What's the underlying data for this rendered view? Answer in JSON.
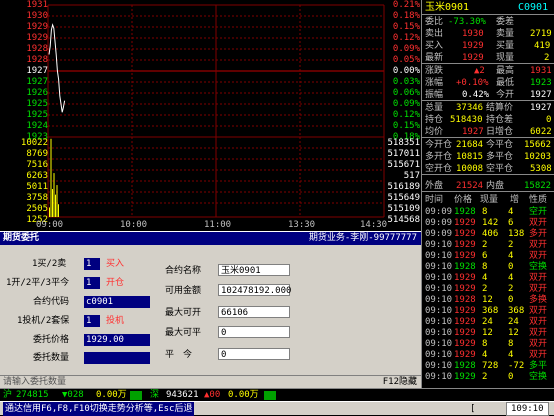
{
  "chart": {
    "price_labels": [
      "1931",
      "1930",
      "1929",
      "1929",
      "1928",
      "1928",
      "1927",
      "1927",
      "1926",
      "1925",
      "1925",
      "1924",
      "1923"
    ],
    "pct_labels": [
      "0.21%",
      "0.18%",
      "0.15%",
      "0.12%",
      "0.09%",
      "0.05%",
      "0.00%",
      "0.03%",
      "0.06%",
      "0.09%",
      "0.12%",
      "0.15%",
      "0.18%"
    ],
    "vol_labels_left": [
      "10022",
      "8769",
      "7516",
      "6263",
      "5011",
      "3758",
      "2505",
      "1252"
    ],
    "vol_labels_right": [
      "518351",
      "517011",
      "515671",
      "517",
      "516189",
      "515649",
      "515109",
      "514568"
    ],
    "time_labels": [
      "09:00",
      "10:00",
      "11:00",
      "13:30",
      "14:30"
    ],
    "price_series": [
      1928,
      1928.5,
      1929.5,
      1929.8,
      1929.6,
      1928.8,
      1928,
      1927,
      1926.5,
      1925.5,
      1925,
      1924.5,
      1924.8,
      1925.2
    ],
    "vol_series": [
      1200,
      9800,
      3500,
      5500,
      2800,
      4000,
      1600
    ]
  },
  "quote": {
    "name": "玉米0901",
    "code": "C0901",
    "weibi_label": "委比",
    "weibi": "-73.30%",
    "weicha_label": "委差",
    "weicha": "",
    "sell_label": "卖出",
    "sell": "1930",
    "sell_vol_label": "卖量",
    "sell_vol": "2719",
    "buy_label": "买入",
    "buy": "1929",
    "buy_vol_label": "买量",
    "buy_vol": "419",
    "latest_label": "最新",
    "latest": "1929",
    "cur_vol_label": "现量",
    "cur_vol": "2",
    "change_label": "涨跌",
    "change": "▲2",
    "high_label": "最高",
    "high": "1931",
    "chg_pct_label": "涨幅",
    "chg_pct": "+0.10%",
    "low_label": "最低",
    "low": "1923",
    "amp_label": "振幅",
    "amp": "0.42%",
    "open_label": "今开",
    "open": "1927",
    "total_label": "总量",
    "total": "37346",
    "settle_label": "结算价",
    "settle": "1927",
    "oi_label": "持仓",
    "oi": "518430",
    "oi_diff_label": "持仓差",
    "oi_diff": "0",
    "avg_label": "均价",
    "avg": "1927",
    "daily_inc_label": "日增仓",
    "daily_inc": "6022",
    "open_today_label": "今开仓",
    "open_today": "21684",
    "close_today_label": "今平仓",
    "close_today": "15662",
    "long_open_label": "多开仓",
    "long_open": "10815",
    "long_close_label": "多平仓",
    "long_close": "10203",
    "short_open_label": "空开仓",
    "short_open": "10008",
    "short_close_label": "空平仓",
    "short_close": "5308",
    "outer_label": "外盘",
    "outer": "21524",
    "inner_label": "内盘",
    "inner": "15822"
  },
  "ticks": {
    "headers": [
      "时间",
      "价格",
      "现量",
      "增",
      "性质"
    ],
    "rows": [
      {
        "time": "09:09",
        "price": "1928",
        "qty": "8",
        "inc": "4",
        "kind": "空开",
        "color": "green"
      },
      {
        "time": "09:09",
        "price": "1929",
        "qty": "142",
        "inc": "6",
        "kind": "双开",
        "color": "red"
      },
      {
        "time": "09:09",
        "price": "1929",
        "qty": "406",
        "inc": "138",
        "kind": "多开",
        "color": "red"
      },
      {
        "time": "09:10",
        "price": "1929",
        "qty": "2",
        "inc": "2",
        "kind": "双开",
        "color": "red"
      },
      {
        "time": "09:10",
        "price": "1929",
        "qty": "6",
        "inc": "4",
        "kind": "双开",
        "color": "red"
      },
      {
        "time": "09:10",
        "price": "1928",
        "qty": "8",
        "inc": "0",
        "kind": "空换",
        "color": "green"
      },
      {
        "time": "09:10",
        "price": "1929",
        "qty": "4",
        "inc": "4",
        "kind": "双开",
        "color": "red"
      },
      {
        "time": "09:10",
        "price": "1929",
        "qty": "2",
        "inc": "2",
        "kind": "双开",
        "color": "red"
      },
      {
        "time": "09:10",
        "price": "1928",
        "qty": "12",
        "inc": "0",
        "kind": "多换",
        "color": "red"
      },
      {
        "time": "09:10",
        "price": "1929",
        "qty": "368",
        "inc": "368",
        "kind": "双开",
        "color": "red"
      },
      {
        "time": "09:10",
        "price": "1929",
        "qty": "24",
        "inc": "24",
        "kind": "双开",
        "color": "red"
      },
      {
        "time": "09:10",
        "price": "1929",
        "qty": "12",
        "inc": "12",
        "kind": "双开",
        "color": "red"
      },
      {
        "time": "09:10",
        "price": "1929",
        "qty": "8",
        "inc": "8",
        "kind": "双开",
        "color": "red"
      },
      {
        "time": "09:10",
        "price": "1929",
        "qty": "4",
        "inc": "4",
        "kind": "双开",
        "color": "red"
      },
      {
        "time": "09:10",
        "price": "1928",
        "qty": "728",
        "inc": "-72",
        "kind": "多平",
        "color": "green"
      },
      {
        "time": "09:10",
        "price": "1929",
        "qty": "2",
        "inc": "0",
        "kind": "空换",
        "color": "green"
      }
    ]
  },
  "order": {
    "title": "期货委托",
    "title_right": "期货业务-李刚-99777777",
    "bs_label": "1买/2卖",
    "bs_value": "1",
    "bs_text": "买入",
    "oc_label": "1开/2平/3平今",
    "oc_value": "1",
    "oc_text": "开仓",
    "code_label": "合约代码",
    "code_value": "c0901",
    "spec_label": "1投机/2套保",
    "spec_value": "1",
    "spec_text": "投机",
    "price_label": "委托价格",
    "price_value": "1929.00",
    "qty_label": "委托数量",
    "qty_value": "",
    "name_label": "合约名称",
    "name_value": "玉米0901",
    "funds_label": "可用金额",
    "funds_value": "102478192.000",
    "max_open_label": "最大可开",
    "max_open_value": "66106",
    "max_close_label": "最大可平",
    "max_close_value": "0",
    "flat_label": "平　今",
    "flat_value": "0",
    "prompt": "请输入委托数量",
    "hide_hint": "F12隐藏"
  },
  "ticker": {
    "sh_label": "沪",
    "sh_index": "274815",
    "sh_change": "▼028",
    "sh_amount": "0.00万",
    "sz_label": "深",
    "sz_index": "943621",
    "sz_change": "▲00",
    "sz_amount": "0.00万"
  },
  "bottom": {
    "text": "通达信用F6,F8,F10切换走势分析等,Esc后退",
    "clock": "109:10"
  }
}
